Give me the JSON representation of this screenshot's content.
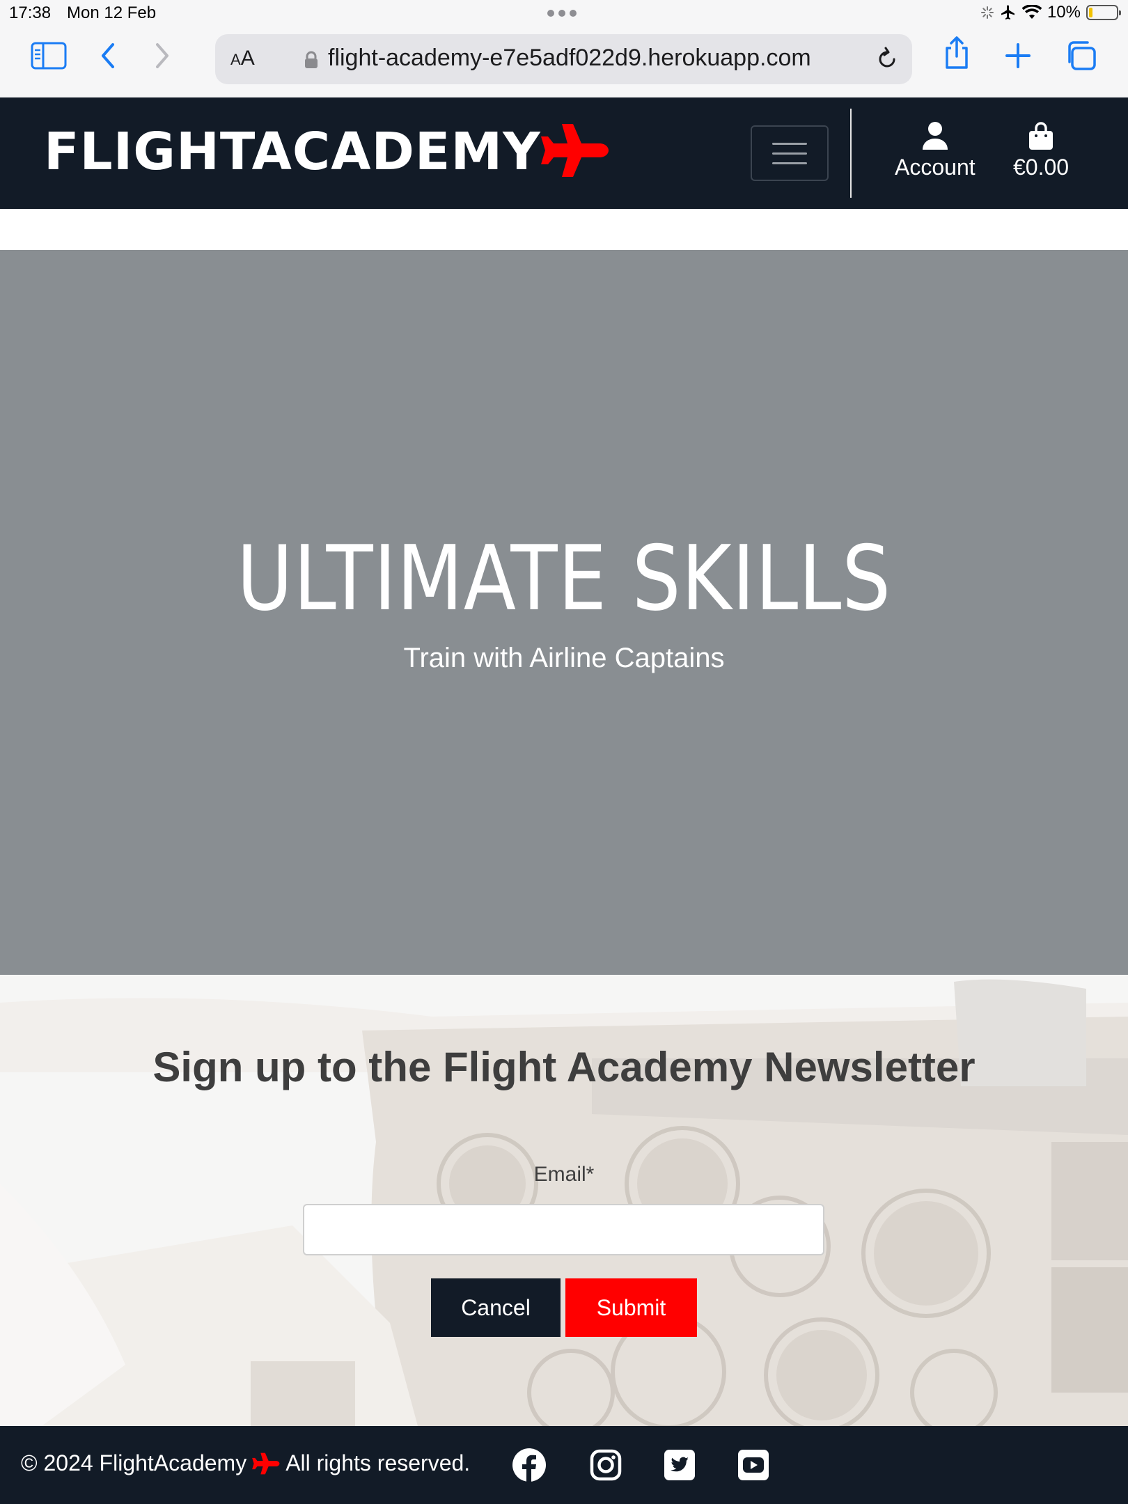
{
  "status_bar": {
    "time": "17:38",
    "date": "Mon 12 Feb",
    "battery": "10%",
    "icons": [
      "loading-spinner-icon",
      "airplane-mode-icon",
      "wifi-icon",
      "battery-icon"
    ]
  },
  "browser": {
    "text_size_label_small": "A",
    "text_size_label_large": "A",
    "url": "flight-academy-e7e5adf022d9.herokuapp.com",
    "toolbar_icons": [
      "sidebar-icon",
      "back-icon",
      "forward-icon",
      "lock-icon",
      "reload-icon",
      "share-icon",
      "new-tab-icon",
      "tabs-icon"
    ]
  },
  "header": {
    "logo_text": "FLIGHTACADEMY",
    "account_label": "Account",
    "bag_total": "€0.00",
    "colors": {
      "background": "#121b27",
      "brand_red": "#ff0000"
    }
  },
  "hero": {
    "title": "ULTIMATE SKILLS",
    "subtitle": "Train with Airline Captains",
    "background": "#898e92"
  },
  "newsletter": {
    "title": "Sign up to the Flight Academy Newsletter",
    "email_label": "Email*",
    "email_value": "",
    "cancel_label": "Cancel",
    "submit_label": "Submit"
  },
  "footer": {
    "copyright_prefix": "© 2024 FlightAcademy",
    "copyright_suffix": "All rights reserved.",
    "social_icons": [
      "facebook-icon",
      "instagram-icon",
      "twitter-icon",
      "youtube-icon"
    ]
  }
}
